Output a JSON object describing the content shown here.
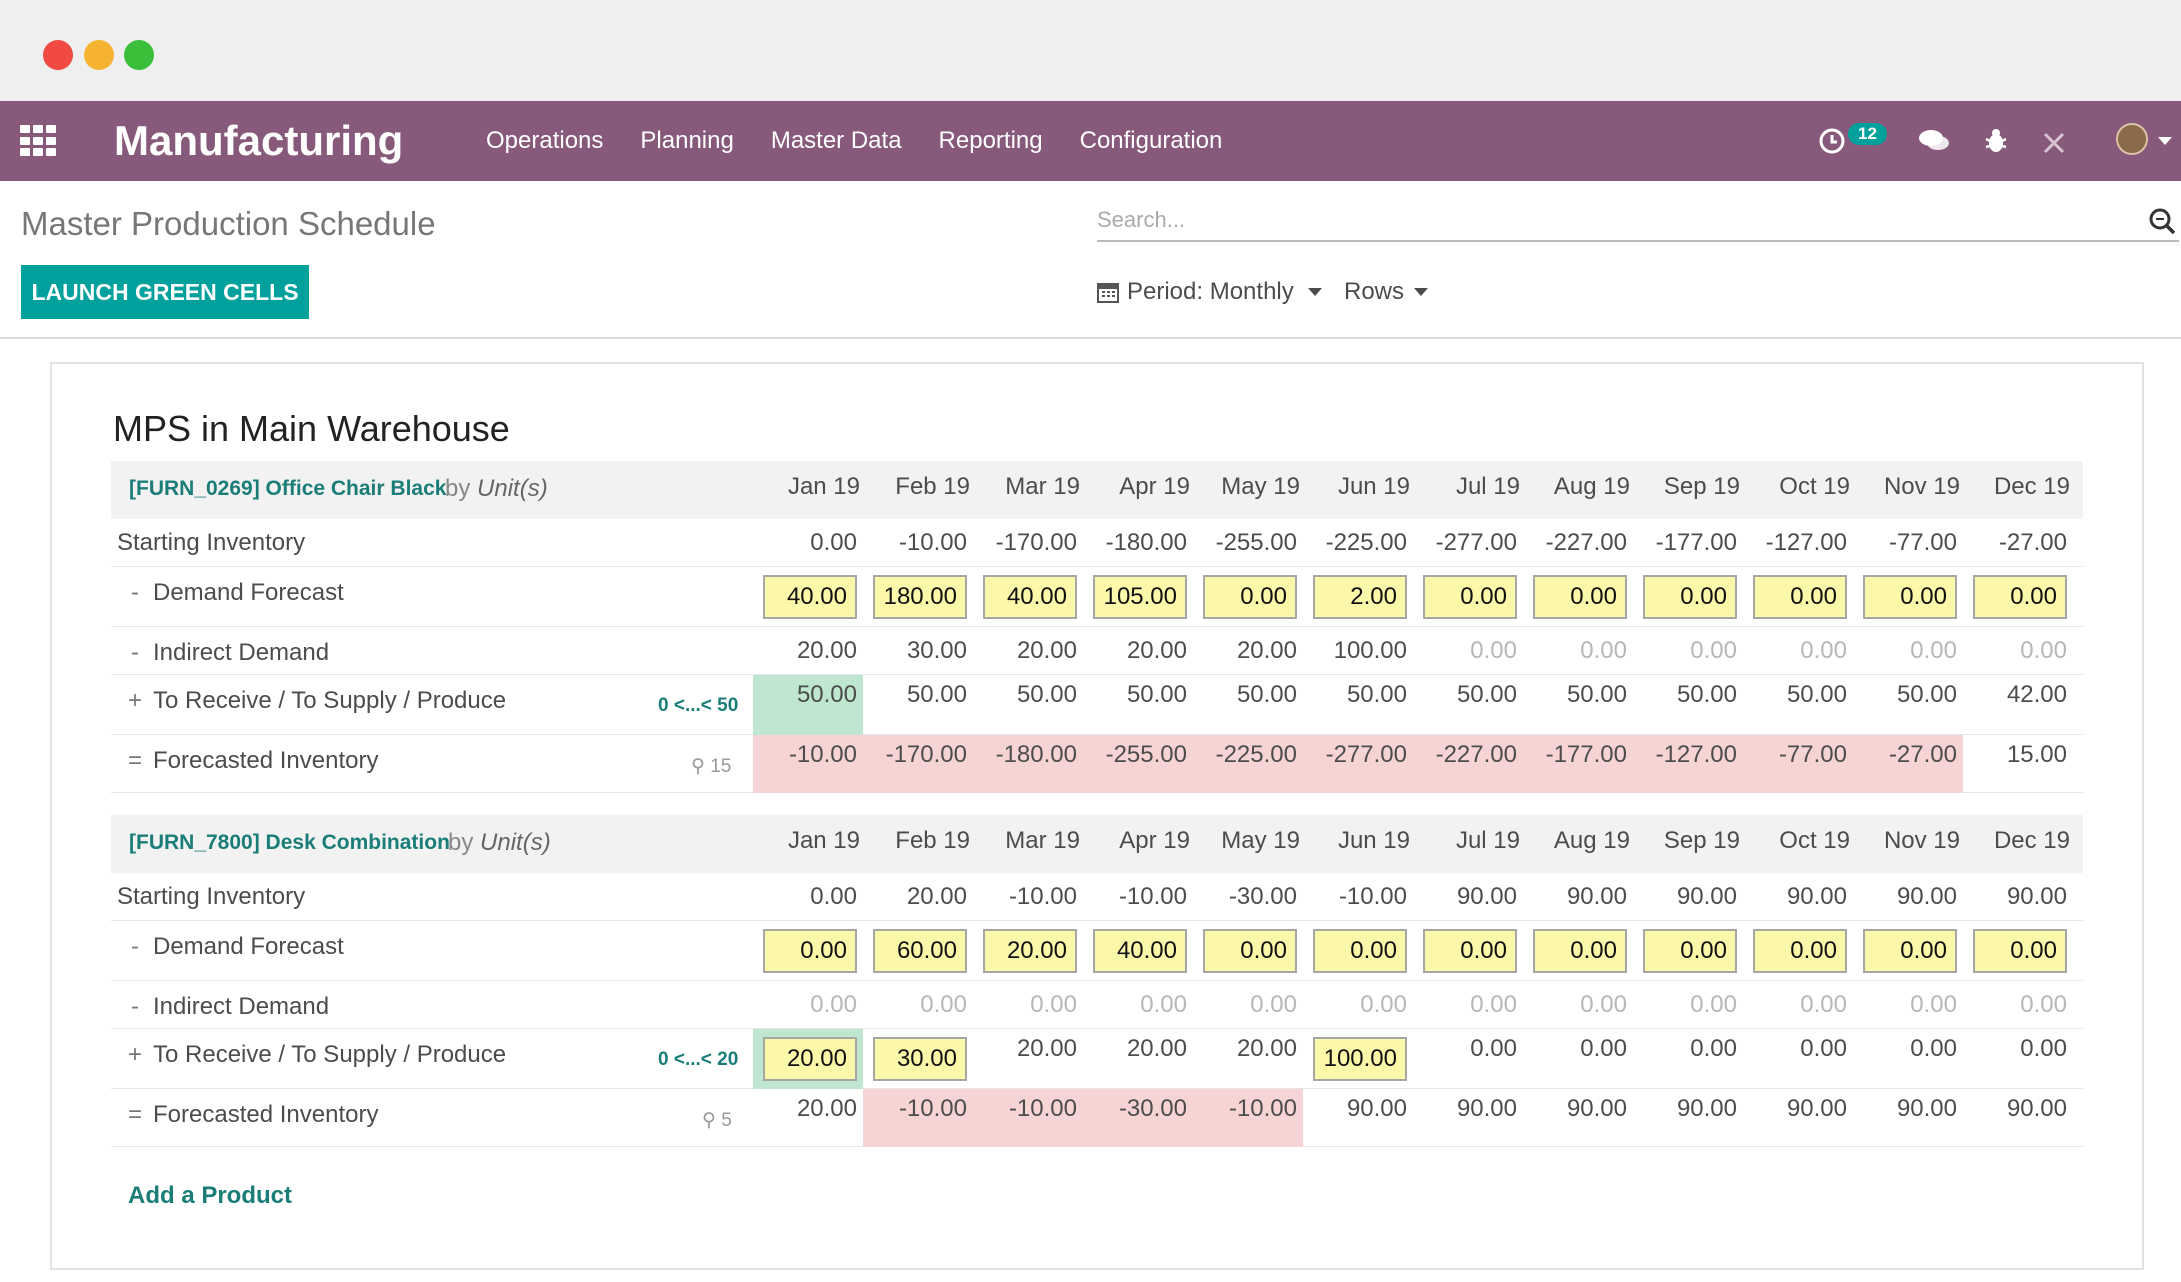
{
  "nav": {
    "app_title": "Manufacturing",
    "menu": [
      "Operations",
      "Planning",
      "Master Data",
      "Reporting",
      "Configuration"
    ],
    "activity_count": "12"
  },
  "control": {
    "breadcrumb": "Master Production Schedule",
    "launch_label": "LAUNCH GREEN CELLS",
    "search_placeholder": "Search...",
    "period_label": "Period: Monthly",
    "rows_label": "Rows"
  },
  "sheet": {
    "title": "MPS in Main Warehouse",
    "add_product": "Add a Product"
  },
  "months": [
    "Jan 19",
    "Feb 19",
    "Mar 19",
    "Apr 19",
    "May 19",
    "Jun 19",
    "Jul 19",
    "Aug 19",
    "Sep 19",
    "Oct 19",
    "Nov 19",
    "Dec 19"
  ],
  "row_labels": {
    "starting": "Starting Inventory",
    "demand": "Demand Forecast",
    "indirect": "Indirect Demand",
    "receive": "To Receive / To Supply / Produce",
    "forecasted": "Forecasted Inventory"
  },
  "ops": {
    "minus": "-",
    "plus": "+",
    "equals": "="
  },
  "by_text": "by",
  "products": [
    {
      "name": "[FURN_0269] Office Chair Black",
      "unit": "Unit(s)",
      "rule": "0 <...< 50",
      "safety": "15",
      "starting": [
        "0.00",
        "-10.00",
        "-170.00",
        "-180.00",
        "-255.00",
        "-225.00",
        "-277.00",
        "-227.00",
        "-177.00",
        "-127.00",
        "-77.00",
        "-27.00"
      ],
      "demand": [
        "40.00",
        "180.00",
        "40.00",
        "105.00",
        "0.00",
        "2.00",
        "0.00",
        "0.00",
        "0.00",
        "0.00",
        "0.00",
        "0.00"
      ],
      "indirect": [
        "20.00",
        "30.00",
        "20.00",
        "20.00",
        "20.00",
        "100.00",
        "0.00",
        "0.00",
        "0.00",
        "0.00",
        "0.00",
        "0.00"
      ],
      "receive": [
        "50.00",
        "50.00",
        "50.00",
        "50.00",
        "50.00",
        "50.00",
        "50.00",
        "50.00",
        "50.00",
        "50.00",
        "50.00",
        "42.00"
      ],
      "forecasted": [
        "-10.00",
        "-170.00",
        "-180.00",
        "-255.00",
        "-225.00",
        "-277.00",
        "-227.00",
        "-177.00",
        "-127.00",
        "-77.00",
        "-27.00",
        "15.00"
      ]
    },
    {
      "name": "[FURN_7800] Desk Combination",
      "unit": "Unit(s)",
      "rule": "0 <...< 20",
      "safety": "5",
      "starting": [
        "0.00",
        "20.00",
        "-10.00",
        "-10.00",
        "-30.00",
        "-10.00",
        "90.00",
        "90.00",
        "90.00",
        "90.00",
        "90.00",
        "90.00"
      ],
      "demand": [
        "0.00",
        "60.00",
        "20.00",
        "40.00",
        "0.00",
        "0.00",
        "0.00",
        "0.00",
        "0.00",
        "0.00",
        "0.00",
        "0.00"
      ],
      "indirect": [
        "0.00",
        "0.00",
        "0.00",
        "0.00",
        "0.00",
        "0.00",
        "0.00",
        "0.00",
        "0.00",
        "0.00",
        "0.00",
        "0.00"
      ],
      "receive": [
        "20.00",
        "30.00",
        "20.00",
        "20.00",
        "20.00",
        "100.00",
        "0.00",
        "0.00",
        "0.00",
        "0.00",
        "0.00",
        "0.00"
      ],
      "forecasted": [
        "20.00",
        "-10.00",
        "-10.00",
        "-30.00",
        "-10.00",
        "90.00",
        "90.00",
        "90.00",
        "90.00",
        "90.00",
        "90.00",
        "90.00"
      ]
    }
  ],
  "colors": {
    "navbar": "#875a7b",
    "primary": "#00a09d",
    "link": "#1a7d78",
    "input_fill": "#fbf8aa",
    "green_cell": "#bfe6cf",
    "red_cell": "#f6d4d4"
  }
}
